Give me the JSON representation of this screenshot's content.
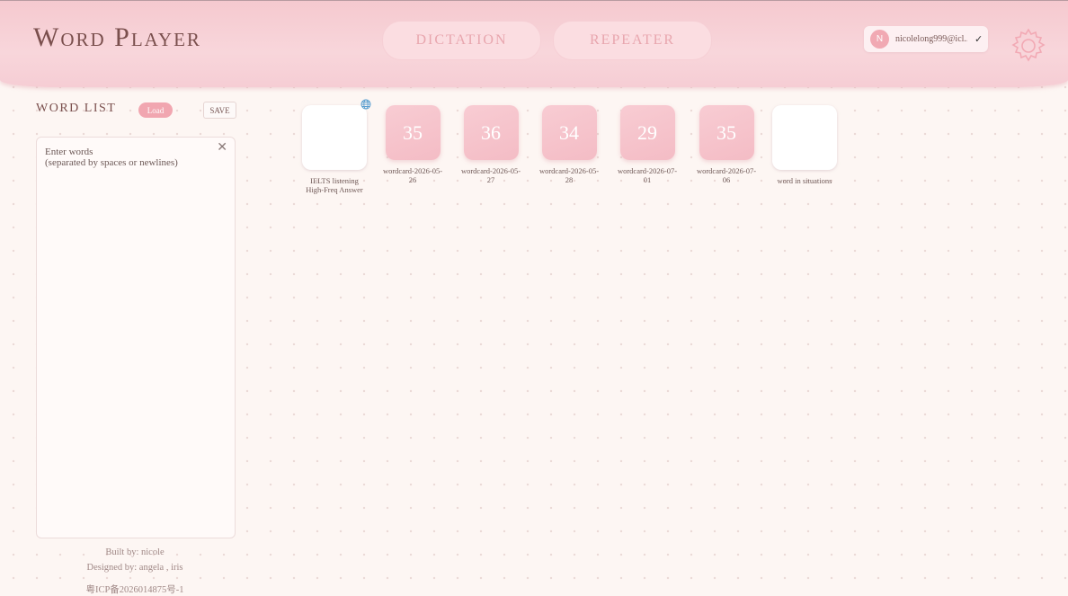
{
  "header": {
    "app_title": "Word Player",
    "modes": [
      "DICTATION",
      "REPEATER"
    ],
    "user": {
      "initial": "N",
      "email": "nicolelong999@icl...",
      "check": "✓"
    }
  },
  "sidebar": {
    "title": "WORD LIST",
    "load_label": "Load",
    "save_label": "SAVE",
    "placeholder": "Enter words\n(separated by spaces or newlines)",
    "clear_label": "✕"
  },
  "credits": {
    "built_by": "Built by:   nicole",
    "designed_by": "Designed by:   angela  ,   iris",
    "icp": "粤ICP备2026014875号-1"
  },
  "decks": [
    {
      "label": "IELTS listening High-Freq Answer",
      "type": "grid",
      "icon": "globe-icon",
      "colors": [
        "#c89be0",
        "#d2a4e6",
        "#c99be0",
        "#b9d7ef"
      ]
    },
    {
      "label": "wordcard-2026-05-26",
      "count": "35"
    },
    {
      "label": "wordcard-2026-05-27",
      "count": "36"
    },
    {
      "label": "wordcard-2026-05-28",
      "count": "34"
    },
    {
      "label": "wordcard-2026-07-01",
      "count": "29"
    },
    {
      "label": "wordcard-2026-07-06",
      "count": "35"
    },
    {
      "label": "word in situations",
      "type": "grid",
      "colors": [
        "#b9c7e6",
        "#f8c48f",
        "#8fe0cc",
        "#d9a4c8"
      ]
    }
  ]
}
